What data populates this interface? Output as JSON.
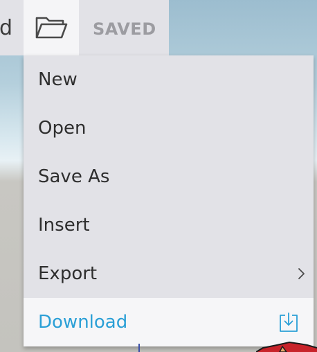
{
  "toolbar": {
    "cut_text": "d",
    "folder_icon": "folder-open-icon",
    "status_label": "SAVED"
  },
  "menu": {
    "items": [
      {
        "label": "New"
      },
      {
        "label": "Open"
      },
      {
        "label": "Save As"
      },
      {
        "label": "Insert"
      },
      {
        "label": "Export",
        "icon": "chevron-right-icon"
      },
      {
        "label": "Download",
        "icon": "download-icon"
      }
    ]
  },
  "colors": {
    "toolbar_bg": "#e2e2e7",
    "menu_bg": "#e2e2e7",
    "download_bg": "#f6f6f8",
    "accent": "#2a9fd6",
    "status_text": "#9c9ca1"
  }
}
